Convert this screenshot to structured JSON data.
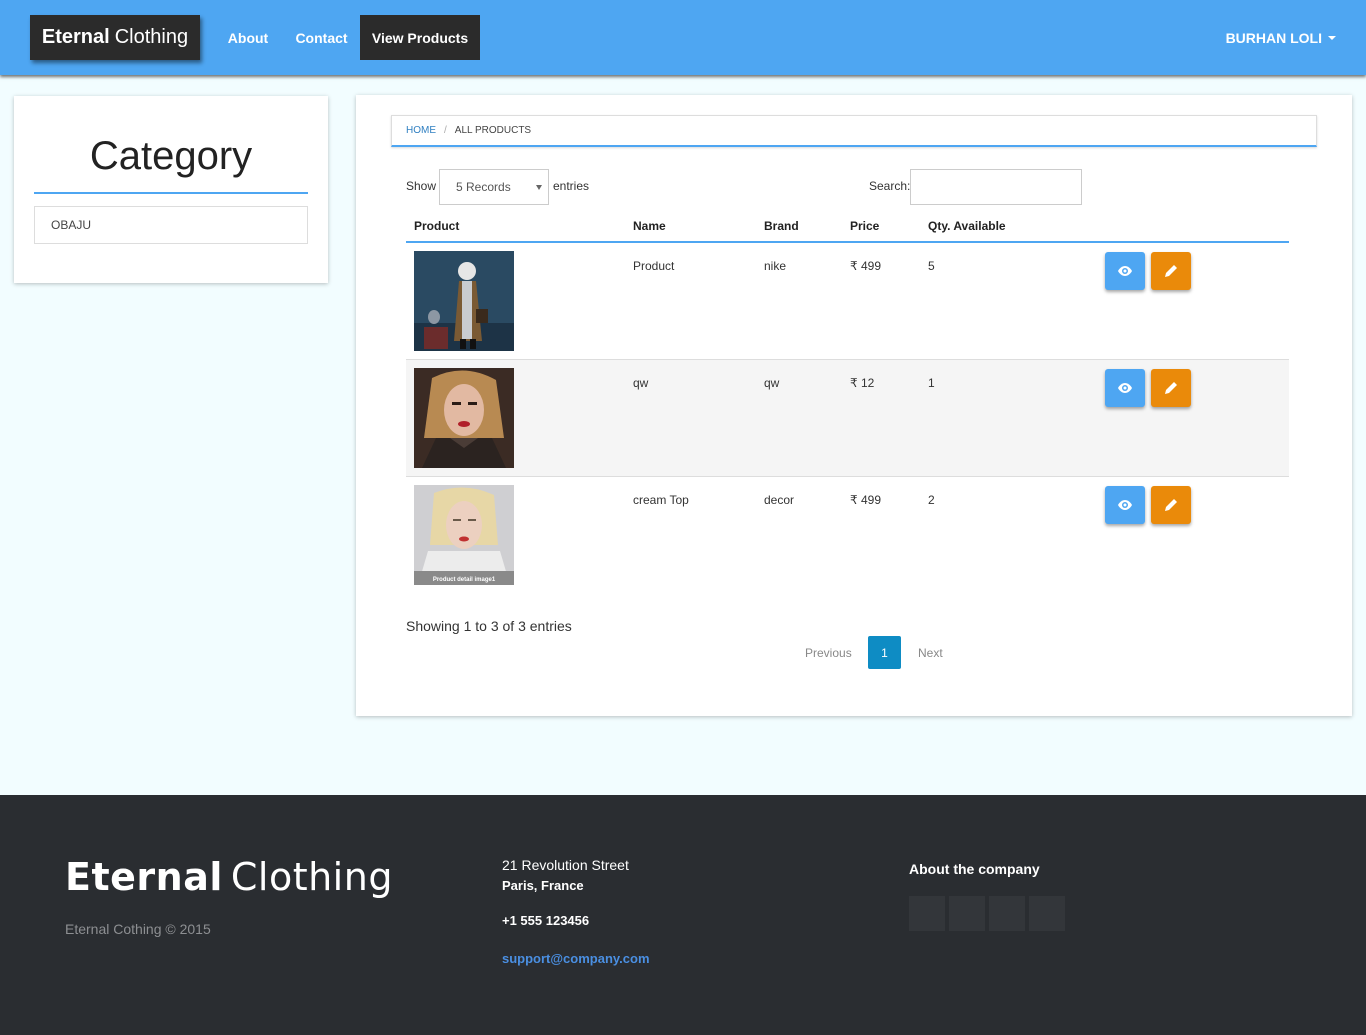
{
  "navbar": {
    "brand_bold": "Eternal",
    "brand_rest": "Clothing",
    "about": "About",
    "contact": "Contact",
    "view_products": "View Products",
    "user": "BURHAN LOLI"
  },
  "sidebar": {
    "title": "Category",
    "items": [
      {
        "label": "OBAJU"
      }
    ]
  },
  "breadcrumb": {
    "home": "HOME",
    "separator": "/",
    "current": "ALL PRODUCTS"
  },
  "table_controls": {
    "show": "Show",
    "select_value": "5 Records",
    "entries": "entries",
    "search": "Search:"
  },
  "table": {
    "headers": [
      "Product",
      "Name",
      "Brand",
      "Price",
      "Qty. Available"
    ],
    "rows": [
      {
        "name": "Product",
        "brand": "nike",
        "price": "₹ 499",
        "qty": "5"
      },
      {
        "name": "qw",
        "brand": "qw",
        "price": "₹ 12",
        "qty": "1"
      },
      {
        "name": "cream Top",
        "brand": "decor",
        "price": "₹ 499",
        "qty": "2",
        "image_caption": "Product detail image1"
      }
    ]
  },
  "pagination": {
    "showing": "Showing 1 to 3 of 3 entries",
    "previous": "Previous",
    "current": "1",
    "next": "Next"
  },
  "footer": {
    "brand_bold": "Eternal",
    "brand_rest": "Clothing",
    "copyright": "Eternal Cothing © 2015",
    "street": "21 Revolution Street",
    "city": "Paris, France",
    "phone": "+1 555 123456",
    "email": "support@company.com",
    "about": "About the company"
  },
  "colors": {
    "navbar": "#4ea6f2",
    "dark": "#2b2b2b",
    "view_button": "#4ea6f2",
    "edit_button": "#ea8a0a",
    "page_active": "#0e8cc4",
    "footer": "#2a2d31"
  },
  "icons": {
    "view": "eye-icon",
    "edit": "pencil-icon",
    "dropdown": "caret-down-icon"
  }
}
